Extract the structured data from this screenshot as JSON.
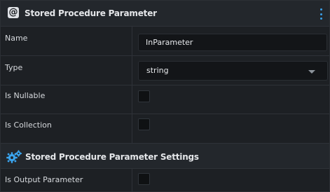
{
  "header": {
    "title": "Stored Procedure Parameter",
    "icon": "at-icon",
    "menu_icon": "kebab-menu-icon",
    "accent_color": "#39a0e8"
  },
  "properties": {
    "name": {
      "label": "Name",
      "value": "InParameter"
    },
    "type": {
      "label": "Type",
      "value": "string"
    },
    "is_nullable": {
      "label": "Is Nullable",
      "checked": false
    },
    "is_collection": {
      "label": "Is Collection",
      "checked": false
    }
  },
  "settings": {
    "title": "Stored Procedure Parameter Settings",
    "icon": "gears-icon",
    "is_output_parameter": {
      "label": "Is Output Parameter",
      "checked": false
    }
  }
}
